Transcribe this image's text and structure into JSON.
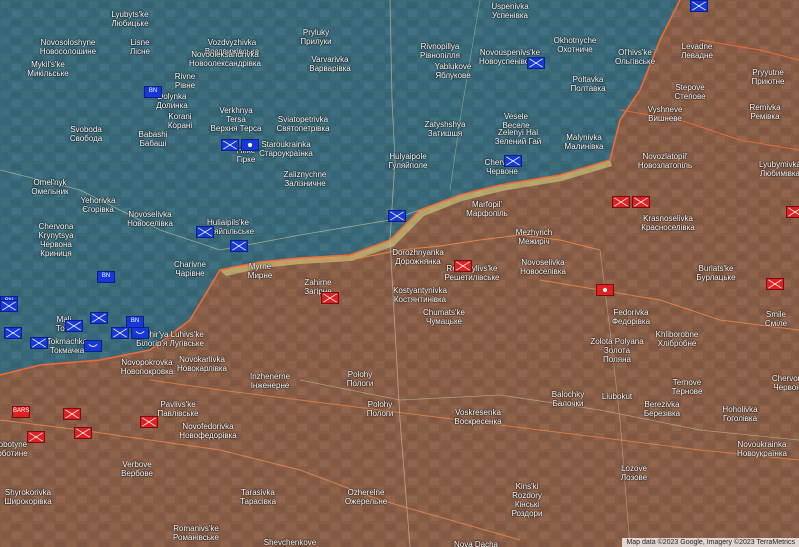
{
  "attribution": "Map data ©2023 Google, Imagery ©2023 TerraMetrics",
  "colors": {
    "ukrainian_zone": "#3f6a78",
    "russian_zone": "#c0704a",
    "contested": "#d8e08a",
    "frontline": "#f06a3a",
    "ua_unit": "#1638d8",
    "ru_unit": "#e02020"
  },
  "place_labels": [
    {
      "id": "lyubyts",
      "lines": [
        "Lyubyts'ke",
        "Любицьке"
      ]
    },
    {
      "id": "uspenivka",
      "lines": [
        "Uspenivka",
        "Успенівка"
      ]
    },
    {
      "id": "vozdvyzhivka",
      "lines": [
        "Vozdvyzhivka",
        "Воздвижівська"
      ]
    },
    {
      "id": "pryluky",
      "lines": [
        "Pryluky",
        "Прилуки"
      ]
    },
    {
      "id": "lisne",
      "lines": [
        "Lisne",
        "Лісне"
      ]
    },
    {
      "id": "novooleksandrivka",
      "lines": [
        "Novooleksandrivka",
        "Новоолександрівка"
      ]
    },
    {
      "id": "novosolosh",
      "lines": [
        "Novosoloshyne",
        "Новосолошине"
      ]
    },
    {
      "id": "varvarivka",
      "lines": [
        "Varvarivka",
        "Варварівка"
      ]
    },
    {
      "id": "rivnopillya",
      "lines": [
        "Rivnopillya",
        "Рівнопілля"
      ]
    },
    {
      "id": "novouspenivske",
      "lines": [
        "Novouspenivs'ke",
        "Новоуспенівське"
      ]
    },
    {
      "id": "okhotnyche",
      "lines": [
        "Okhotnyche",
        "Охотниче"
      ]
    },
    {
      "id": "olhivske",
      "lines": [
        "Ol'hivs'ke",
        "Ольгівське"
      ]
    },
    {
      "id": "levadne",
      "lines": [
        "Levadne",
        "Левадне"
      ]
    },
    {
      "id": "pryyutne",
      "lines": [
        "Pryyutne",
        "Приютне"
      ]
    },
    {
      "id": "mykilske",
      "lines": [
        "Mykil's'ke",
        "Микільське"
      ]
    },
    {
      "id": "yablukove",
      "lines": [
        "Yablukove",
        "Яблукове"
      ]
    },
    {
      "id": "poltavka",
      "lines": [
        "Poltavka",
        "Полтавка"
      ]
    },
    {
      "id": "rivne",
      "lines": [
        "Rivne",
        "Рівне"
      ]
    },
    {
      "id": "dolynka",
      "lines": [
        "Dolynka",
        "Долинка"
      ]
    },
    {
      "id": "stepove",
      "lines": [
        "Stepove",
        "Степове"
      ]
    },
    {
      "id": "remivka",
      "lines": [
        "Remivka",
        "Ремівка"
      ]
    },
    {
      "id": "verkhnya_tersa",
      "lines": [
        "Verkhnya",
        "Tersa",
        "Верхня Терса"
      ]
    },
    {
      "id": "sviatopetrivka",
      "lines": [
        "Sviatopetrivka",
        "Святопетрівка"
      ]
    },
    {
      "id": "vyshneve",
      "lines": [
        "Vyshneve",
        "Вишневе"
      ]
    },
    {
      "id": "svoboda",
      "lines": [
        "Svoboda",
        "Свобода"
      ]
    },
    {
      "id": "korani",
      "lines": [
        "Korani",
        "Корані"
      ]
    },
    {
      "id": "babashi",
      "lines": [
        "Babashi",
        "Бабаші"
      ]
    },
    {
      "id": "zatyshshya",
      "lines": [
        "Zatyshshya",
        "Затишшя"
      ]
    },
    {
      "id": "vesele",
      "lines": [
        "Vesele",
        "Веселе"
      ]
    },
    {
      "id": "zelenyi_hai",
      "lines": [
        "Zelenyi Hai",
        "Зелений Гай"
      ]
    },
    {
      "id": "malynivka",
      "lines": [
        "Malynivka",
        "Малинівка"
      ]
    },
    {
      "id": "starourkrainka",
      "lines": [
        "Staroukrainka",
        "Староукраїнка"
      ]
    },
    {
      "id": "hirke",
      "lines": [
        "Hirke",
        "Гірке"
      ]
    },
    {
      "id": "novozlatopil",
      "lines": [
        "Novozlatopil'",
        "Новозлатопіль"
      ]
    },
    {
      "id": "lyubymivka",
      "lines": [
        "Lyubymivka",
        "Любимівка"
      ]
    },
    {
      "id": "huliaipole",
      "lines": [
        "Hulyaipole",
        "Гуляйполе"
      ]
    },
    {
      "id": "chervone",
      "lines": [
        "Chervone",
        "Червоне"
      ]
    },
    {
      "id": "zaliznychne",
      "lines": [
        "Zaliznychne",
        "Залізничне"
      ]
    },
    {
      "id": "omelnyk",
      "lines": [
        "Omel'nyk",
        "Омельник"
      ]
    },
    {
      "id": "yehorivka",
      "lines": [
        "Yehorivka",
        "Єгорівка"
      ]
    },
    {
      "id": "marfopil",
      "lines": [
        "Marfopil'",
        "Марфопіль"
      ]
    },
    {
      "id": "novoselivka1",
      "lines": [
        "Novoselivka",
        "Новоселівка"
      ]
    },
    {
      "id": "huliaipilske",
      "lines": [
        "Huliaipils'ke",
        "Гуляйпільське"
      ]
    },
    {
      "id": "krasnoselivka",
      "lines": [
        "Krasnoselivka",
        "Красноселівка"
      ]
    },
    {
      "id": "chervona_krynytsia",
      "lines": [
        "Chervona",
        "Krynytsya",
        "Червона",
        "Криниця"
      ]
    },
    {
      "id": "mezhyrich",
      "lines": [
        "Mezhyrich",
        "Межиріч"
      ]
    },
    {
      "id": "dorozhnianka",
      "lines": [
        "Dorozhnyanka",
        "Дорожнянка"
      ]
    },
    {
      "id": "novoselivka2",
      "lines": [
        "Novoselivka",
        "Новоселівка"
      ]
    },
    {
      "id": "charivne",
      "lines": [
        "Charivne",
        "Чарівне"
      ]
    },
    {
      "id": "myrne",
      "lines": [
        "Myrne",
        "Мирне"
      ]
    },
    {
      "id": "reshetylivske",
      "lines": [
        "Reshetylivs'ke",
        "Решетилівське"
      ]
    },
    {
      "id": "burlatske",
      "lines": [
        "Burlats'ke",
        "Бурлацьке"
      ]
    },
    {
      "id": "zahirne",
      "lines": [
        "Zahirne",
        "Загірне"
      ]
    },
    {
      "id": "kostiantynivka",
      "lines": [
        "Kostyantynivka",
        "Костянтинівка"
      ]
    },
    {
      "id": "smile",
      "lines": [
        "Smile",
        "Сміле"
      ]
    },
    {
      "id": "fedorivka",
      "lines": [
        "Fedorivka",
        "Федорівка"
      ]
    },
    {
      "id": "malynivka_s",
      "lines": [
        "Mali",
        "Токт"
      ]
    },
    {
      "id": "luhivske",
      "lines": [
        "Bilohir'ya Luhivs'ke",
        "Білогір'я Лугівське"
      ]
    },
    {
      "id": "tokmachka",
      "lines": [
        "Tokmachka",
        "Токмачка"
      ]
    },
    {
      "id": "chumatske",
      "lines": [
        "Chumats'ke",
        "Чумацьке"
      ]
    },
    {
      "id": "khliborobne",
      "lines": [
        "Khliborobne",
        "Хлібробне"
      ]
    },
    {
      "id": "zolota_polyana",
      "lines": [
        "Zolota Polyana",
        "Золота",
        "Поляна"
      ]
    },
    {
      "id": "novopokrovka",
      "lines": [
        "Novopokrovka",
        "Новопокровка"
      ]
    },
    {
      "id": "novokarlivka",
      "lines": [
        "Novokarlivka",
        "Новокарлівка"
      ]
    },
    {
      "id": "inzhenerne",
      "lines": [
        "Inzhenerne",
        "Інженерне"
      ]
    },
    {
      "id": "polohy",
      "lines": [
        "Polohy",
        "Пологи"
      ]
    },
    {
      "id": "ternove",
      "lines": [
        "Ternove",
        "Тернове"
      ]
    },
    {
      "id": "chervon_e",
      "lines": [
        "Chervon",
        "Червон"
      ]
    },
    {
      "id": "balochky",
      "lines": [
        "Balochky",
        "Балочки"
      ]
    },
    {
      "id": "liubokut",
      "lines": [
        "Liubokut"
      ]
    },
    {
      "id": "pavlivske",
      "lines": [
        "Pavlivs'ke",
        "Павлівське"
      ]
    },
    {
      "id": "polohy2",
      "lines": [
        "Polohy",
        "Пологи"
      ]
    },
    {
      "id": "voskresenka",
      "lines": [
        "Voskresenka",
        "Воскресенка"
      ]
    },
    {
      "id": "berezivka",
      "lines": [
        "Berezivka",
        "Березівка"
      ]
    },
    {
      "id": "hoholivka",
      "lines": [
        "Hoholivka",
        "Гоголівка"
      ]
    },
    {
      "id": "novofedorivka",
      "lines": [
        "Novofedorivka",
        "Новофедорівка"
      ]
    },
    {
      "id": "novoukrainka",
      "lines": [
        "Novoukrainka",
        "Новоукраїнка"
      ]
    },
    {
      "id": "robotyne",
      "lines": [
        "Robotyne",
        "Роботине"
      ]
    },
    {
      "id": "verbove",
      "lines": [
        "Verbove",
        "Вербове"
      ]
    },
    {
      "id": "lozove",
      "lines": [
        "Lozove",
        "Лозове"
      ]
    },
    {
      "id": "kinski_rozdory",
      "lines": [
        "Kins'ki",
        "Rozdory",
        "Кінські",
        "Роздори"
      ]
    },
    {
      "id": "shyrokorivka",
      "lines": [
        "Shyrokorivka",
        "Широкорівка"
      ]
    },
    {
      "id": "tarasivka",
      "lines": [
        "Tarasivka",
        "Тарасівка"
      ]
    },
    {
      "id": "ozherelne",
      "lines": [
        "Ozherelne",
        "Ожерельне"
      ]
    },
    {
      "id": "romanivske",
      "lines": [
        "Romanivs'ke",
        "Романівське"
      ]
    },
    {
      "id": "shevchenkove",
      "lines": [
        "Shevchenkove",
        "Шевченкове"
      ]
    },
    {
      "id": "nova_dacha",
      "lines": [
        "Nova Dacha"
      ]
    }
  ],
  "units": [
    {
      "id": "u1",
      "side": "ua",
      "type": "infantry"
    },
    {
      "id": "u2",
      "side": "ua",
      "type": "infantry"
    },
    {
      "id": "u3",
      "side": "ua",
      "type": "inf-text",
      "text": "BN"
    },
    {
      "id": "u4",
      "side": "ua",
      "type": "infantry"
    },
    {
      "id": "u5",
      "side": "ua",
      "type": "hq"
    },
    {
      "id": "u6",
      "side": "ua",
      "type": "infantry"
    },
    {
      "id": "u7",
      "side": "ua",
      "type": "infantry"
    },
    {
      "id": "u8",
      "side": "ua",
      "type": "infantry"
    },
    {
      "id": "u9",
      "side": "ua",
      "type": "infantry"
    },
    {
      "id": "u10",
      "side": "ua",
      "type": "inf-text",
      "text": "BN"
    },
    {
      "id": "u11",
      "side": "ua",
      "type": "inf-text",
      "text": "BN"
    },
    {
      "id": "u12",
      "side": "ua",
      "type": "infantry"
    },
    {
      "id": "u13",
      "side": "ua",
      "type": "infantry"
    },
    {
      "id": "u14",
      "side": "ua",
      "type": "infantry"
    },
    {
      "id": "u15",
      "side": "ua",
      "type": "airborne"
    },
    {
      "id": "u16",
      "side": "ua",
      "type": "airborne"
    },
    {
      "id": "u17",
      "side": "ua",
      "type": "infantry"
    },
    {
      "id": "u18",
      "side": "ua",
      "type": "inf-text",
      "text": "BN"
    },
    {
      "id": "u19",
      "side": "ua",
      "type": "infantry"
    },
    {
      "id": "u20",
      "side": "ua",
      "type": "infantry"
    },
    {
      "id": "r1",
      "side": "ru",
      "type": "infantry"
    },
    {
      "id": "r2",
      "side": "ru",
      "type": "infantry"
    },
    {
      "id": "r3",
      "side": "ru",
      "type": "infantry"
    },
    {
      "id": "r4",
      "side": "ru",
      "type": "hq"
    },
    {
      "id": "r5",
      "side": "ru",
      "type": "infantry"
    },
    {
      "id": "r6",
      "side": "ru",
      "type": "infantry"
    },
    {
      "id": "r7",
      "side": "ru",
      "type": "inf-text",
      "text": "BARS"
    },
    {
      "id": "r8",
      "side": "ru",
      "type": "infantry"
    },
    {
      "id": "r9",
      "side": "ru",
      "type": "infantry"
    },
    {
      "id": "r10",
      "side": "ru",
      "type": "infantry"
    },
    {
      "id": "r11",
      "side": "ru",
      "type": "infantry"
    },
    {
      "id": "r12",
      "side": "ru",
      "type": "infantry"
    }
  ]
}
